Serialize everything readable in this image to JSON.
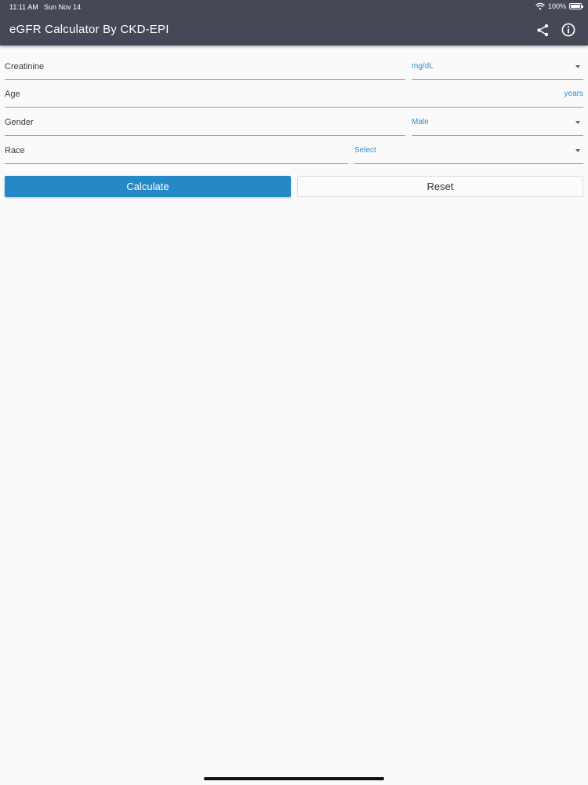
{
  "status_bar": {
    "time": "11:11 AM",
    "date": "Sun Nov 14",
    "battery_text": "100%",
    "battery_level": 1.0
  },
  "app_bar": {
    "title": "eGFR Calculator By CKD-EPI",
    "background_color": "#454956",
    "icons": [
      "share-icon",
      "info-icon"
    ]
  },
  "form": {
    "creatinine": {
      "label": "Creatinine",
      "unit_select": "mg/dL"
    },
    "age": {
      "label": "Age",
      "unit": "years"
    },
    "gender": {
      "label": "Gender",
      "select": "Male"
    },
    "race": {
      "label": "Race",
      "select": "Select"
    }
  },
  "buttons": {
    "calculate": "Calculate",
    "reset": "Reset"
  },
  "colors": {
    "accent": "#2e8fcf",
    "primary_button": "#2589c8"
  }
}
